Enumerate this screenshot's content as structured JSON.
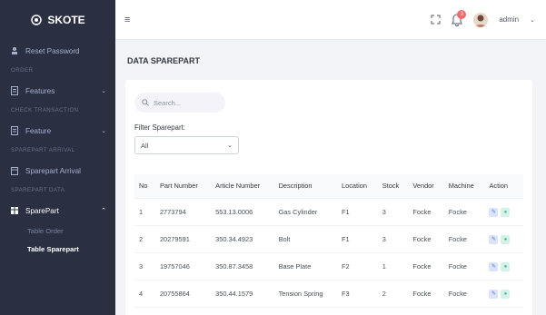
{
  "brand": {
    "name": "SKOTE"
  },
  "sidebar": {
    "items": [
      {
        "type": "item",
        "label": "Reset Password",
        "icon": "user-icon"
      },
      {
        "type": "title",
        "label": "ORDER"
      },
      {
        "type": "item",
        "label": "Features",
        "icon": "document-icon",
        "chevron": "v"
      },
      {
        "type": "title",
        "label": "CHECK TRANSACTION"
      },
      {
        "type": "item",
        "label": "Feature",
        "icon": "document-icon",
        "chevron": "v"
      },
      {
        "type": "title",
        "label": "SPAREPART ARRIVAL"
      },
      {
        "type": "item",
        "label": "Sparepart Arrival",
        "icon": "calendar-icon"
      },
      {
        "type": "title",
        "label": "SPAREPART DATA"
      },
      {
        "type": "item",
        "label": "SparePart",
        "icon": "grid-icon",
        "chevron": "^",
        "active": true
      },
      {
        "type": "sub",
        "label": "Table Order"
      },
      {
        "type": "sub",
        "label": "Table Sparepart",
        "active": true
      }
    ]
  },
  "topbar": {
    "user": "admin",
    "notification_count": "3"
  },
  "page": {
    "title": "DATA SPAREPART"
  },
  "search": {
    "placeholder": "Search..."
  },
  "filter": {
    "label": "Filter Sparepart:",
    "value": "All"
  },
  "table": {
    "headers": [
      "No",
      "Part Number",
      "Article Number",
      "Description",
      "Location",
      "Stock",
      "Vendor",
      "Machine",
      "Action"
    ],
    "rows": [
      [
        "1",
        "2773794",
        "553.13.0006",
        "Gas Cylinder",
        "F1",
        "3",
        "Focke",
        "Focke"
      ],
      [
        "2",
        "20279591",
        "350.34.4923",
        "Bolt",
        "F1",
        "3",
        "Focke",
        "Focke"
      ],
      [
        "3",
        "19757046",
        "350.87.3458",
        "Base Plate",
        "F2",
        "1",
        "Focke",
        "Focke"
      ],
      [
        "4",
        "20755864",
        "350.44.1579",
        "Tension Spring",
        "F3",
        "2",
        "Focke",
        "Focke"
      ]
    ]
  },
  "colors": {
    "sidebar": "#2a3042",
    "edit": "#556ee6",
    "view": "#34c38f",
    "badge": "#f46a6a"
  }
}
